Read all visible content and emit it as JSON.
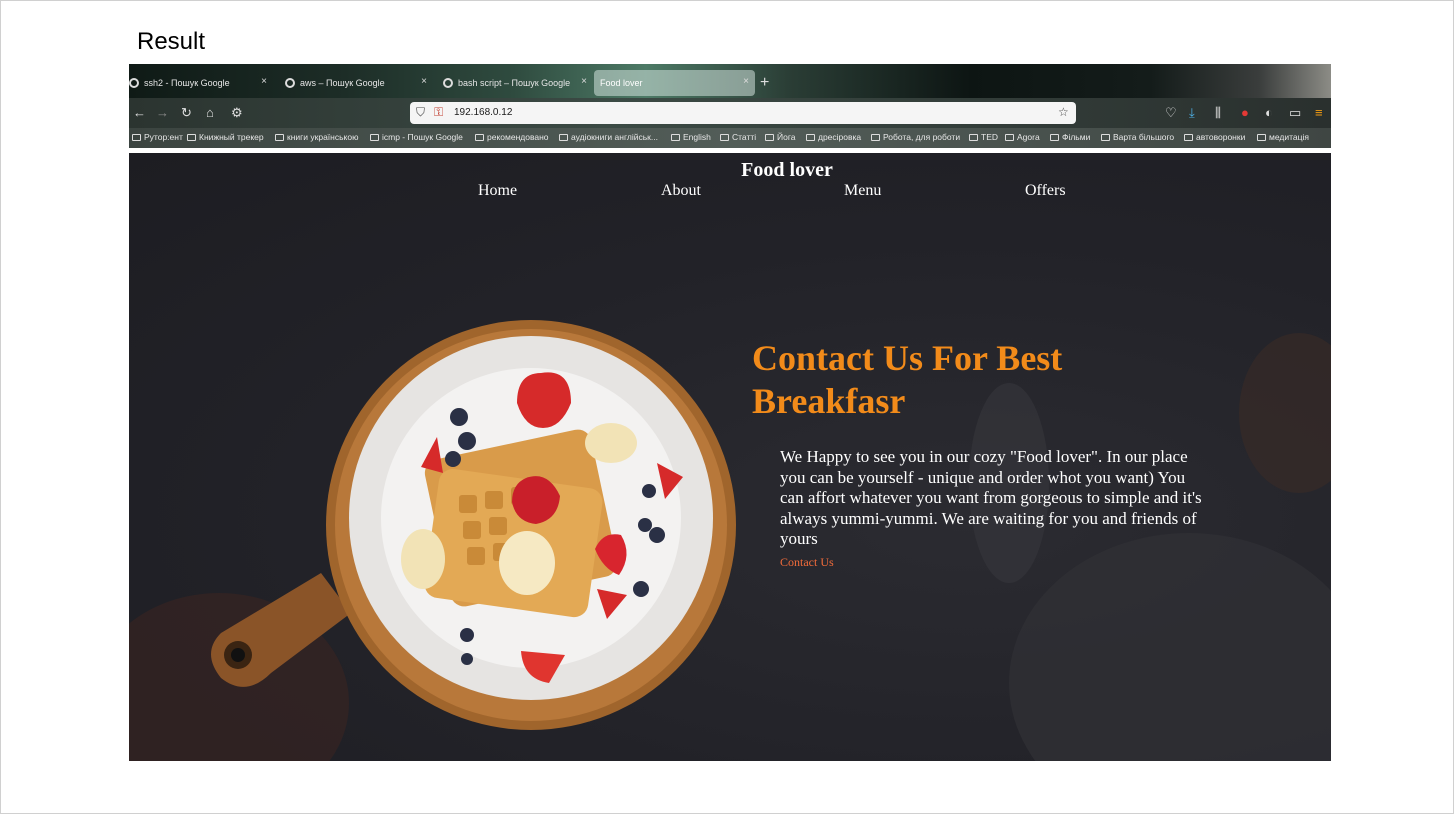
{
  "slide": {
    "title": "Result"
  },
  "browser": {
    "tabs": [
      {
        "label": "ssh2 - Пошук Google",
        "active": false
      },
      {
        "label": "aws – Пошук Google",
        "active": false
      },
      {
        "label": "bash script – Пошук Google",
        "active": false
      },
      {
        "label": "Food lover",
        "active": true
      }
    ],
    "tab_close": "×",
    "new_tab": "+",
    "url": "192.168.0.12",
    "bookmarks": [
      "Рутор:ент",
      "Книжный трекер",
      "книги українською",
      "icmp - Пошук Google",
      "рекомендовано",
      "аудіокниги англійськ...",
      "English",
      "Статті",
      "Йога",
      "дресіровка",
      "Робота, для роботи",
      "TED",
      "Agora",
      "Фільми",
      "Варта більшого",
      "автоворонки",
      "медитація"
    ]
  },
  "site": {
    "title": "Food lover",
    "nav": [
      "Home",
      "About",
      "Menu",
      "Offers"
    ],
    "hero_title": "Contact Us For Best Breakfasr",
    "hero_text": "We Happy to see you in our cozy \"Food lover\". In our place you can be yourself - unique and order whot you want) You can affort whatever you want from gorgeous to simple and it's always yummi-yummi. We are waiting for you and friends of yours",
    "contact_link": "Contact Us",
    "accent_color": "#f28b1a",
    "link_color": "#f26b3a"
  }
}
